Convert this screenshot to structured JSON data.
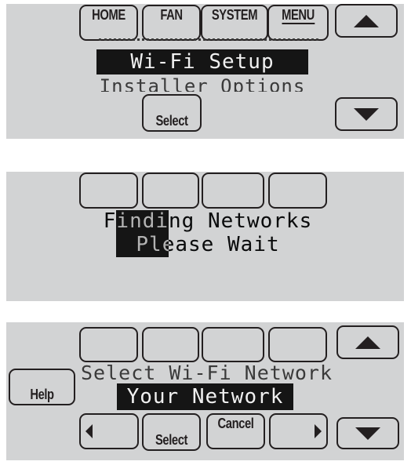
{
  "screen1": {
    "buttons": {
      "home": "HOME",
      "fan": "FAN",
      "system": "SYSTEM",
      "menu": "MENU",
      "select": "Select"
    },
    "menu_items": [
      {
        "label": "Wi-Fi Setup",
        "selected": true
      },
      {
        "label": "Installer Options",
        "selected": false
      }
    ],
    "icons": {
      "up": "arrow-up-icon",
      "down": "arrow-down-icon"
    }
  },
  "screen2": {
    "message_line1": "Finding Networks",
    "message_line2": "Please Wait",
    "status": "searching"
  },
  "screen3": {
    "heading": "Select Wi-Fi Network",
    "network": "Your Network",
    "buttons": {
      "help": "Help",
      "select": "Select",
      "cancel": "Cancel"
    },
    "icons": {
      "up": "arrow-up-icon",
      "down": "arrow-down-icon",
      "left": "arrow-left-icon",
      "right": "arrow-right-icon"
    }
  }
}
